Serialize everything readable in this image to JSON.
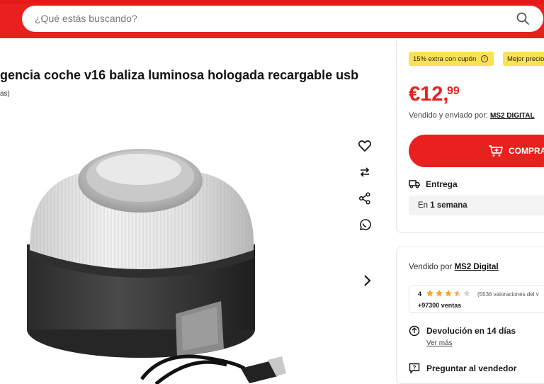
{
  "header": {
    "search_placeholder": "¿Qué estás buscando?",
    "brand_color": "#e8211f"
  },
  "product": {
    "title": "gencia coche v16 baliza luminosa hologada recargable usb",
    "subtitle_fragment": "as)"
  },
  "side_actions": [
    {
      "icon": "heart-icon"
    },
    {
      "icon": "compare-arrows-icon"
    },
    {
      "icon": "share-icon"
    },
    {
      "icon": "whatsapp-icon"
    }
  ],
  "purchase": {
    "badge_coupon": "15% extra con cupón",
    "badge_best_price": "Mejor precio",
    "price_main": "€12,",
    "price_cents": "99",
    "sold_sent_by": "Vendido y enviado por:",
    "seller_short": "MS2 DIGITAL",
    "buy_label": "COMPRAR",
    "delivery_title": "Entrega",
    "delivery_prefix": "En",
    "delivery_time": "1 semana"
  },
  "seller": {
    "sold_by_label": "Vendido por",
    "seller_name": "MS2 Digital",
    "rating_value": "4",
    "rating_stars": 3.5,
    "rating_count": "(5536 valoraciones del v",
    "sales": "+97300 ventas",
    "return_title": "Devolución en 14 días",
    "return_link": "Ver más",
    "ask_seller": "Preguntar al vendedor"
  }
}
